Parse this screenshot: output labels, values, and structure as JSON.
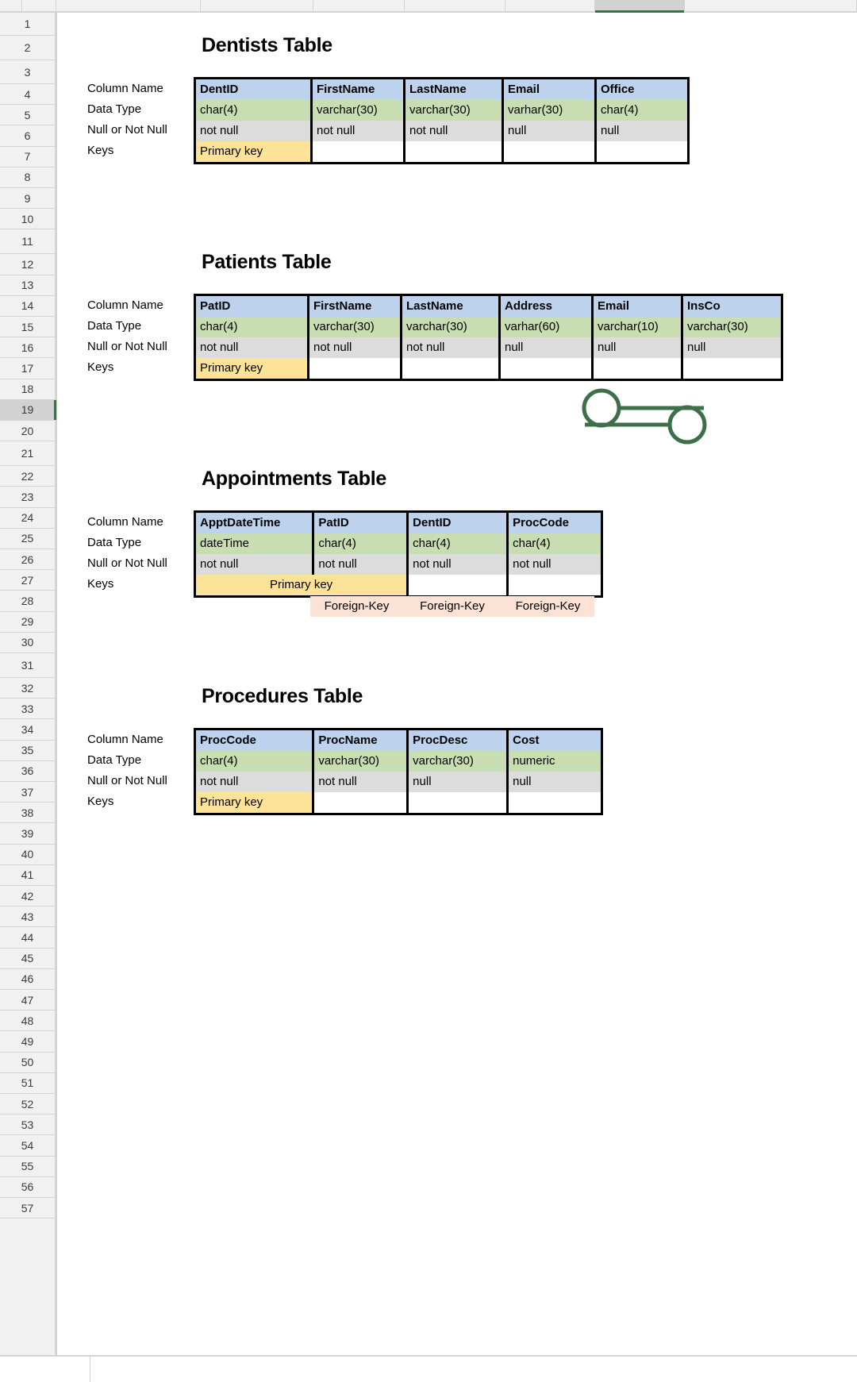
{
  "app": {
    "type": "spreadsheet",
    "selected_row": "19"
  },
  "row_headers": [
    "1",
    "2",
    "3",
    "4",
    "5",
    "6",
    "7",
    "8",
    "9",
    "10",
    "11",
    "12",
    "13",
    "14",
    "15",
    "16",
    "17",
    "18",
    "19",
    "20",
    "21",
    "22",
    "23",
    "24",
    "25",
    "26",
    "27",
    "28",
    "29",
    "30",
    "31",
    "32",
    "33",
    "34",
    "35",
    "36",
    "37",
    "38",
    "39",
    "40",
    "41",
    "42",
    "43",
    "44",
    "45",
    "46",
    "47",
    "48",
    "49",
    "50",
    "51",
    "52",
    "53",
    "54",
    "55",
    "56",
    "57"
  ],
  "row_labels": {
    "column_name": "Column Name",
    "data_type": "Data Type",
    "null_or_not_null": "Null or Not Null",
    "keys": "Keys"
  },
  "colors": {
    "header_blue": "#bdd2ec",
    "type_green": "#c9ddb2",
    "null_gray": "#dcdcdc",
    "primary_key_yellow": "#fce398",
    "foreign_key_peach": "#fbe2d5",
    "link_green": "#3d7049",
    "selection_green": "#3d7049"
  },
  "tables": [
    {
      "title": "Dentists Table",
      "columns": [
        {
          "name": "DentID",
          "type": "char(4)",
          "null": "not null",
          "key": "Primary key"
        },
        {
          "name": "FirstName",
          "type": "varchar(30)",
          "null": "not null",
          "key": ""
        },
        {
          "name": "LastName",
          "type": "varchar(30)",
          "null": "not null",
          "key": ""
        },
        {
          "name": "Email",
          "type": "varhar(30)",
          "null": "null",
          "key": ""
        },
        {
          "name": "Office",
          "type": "char(4)",
          "null": "null",
          "key": ""
        }
      ]
    },
    {
      "title": "Patients Table",
      "columns": [
        {
          "name": "PatID",
          "type": "char(4)",
          "null": "not null",
          "key": "Primary key"
        },
        {
          "name": "FirstName",
          "type": "varchar(30)",
          "null": "not null",
          "key": ""
        },
        {
          "name": "LastName",
          "type": "varchar(30)",
          "null": "not null",
          "key": ""
        },
        {
          "name": "Address",
          "type": "varhar(60)",
          "null": "null",
          "key": ""
        },
        {
          "name": "Email",
          "type": "varchar(10)",
          "null": "null",
          "key": ""
        },
        {
          "name": "InsCo",
          "type": "varchar(30)",
          "null": "null",
          "key": ""
        }
      ]
    },
    {
      "title": "Appointments Table",
      "columns": [
        {
          "name": "ApptDateTime",
          "type": "dateTime",
          "null": "not null",
          "key": "Primary key"
        },
        {
          "name": "PatID",
          "type": "char(4)",
          "null": "not null",
          "key": ""
        },
        {
          "name": "DentID",
          "type": "char(4)",
          "null": "not null",
          "key": ""
        },
        {
          "name": "ProcCode",
          "type": "char(4)",
          "null": "not null",
          "key": ""
        }
      ],
      "primary_key_span": 2,
      "foreign_keys": [
        "",
        "Foreign-Key",
        "Foreign-Key",
        "Foreign-Key"
      ]
    },
    {
      "title": "Procedures Table",
      "columns": [
        {
          "name": "ProcCode",
          "type": "char(4)",
          "null": "not null",
          "key": "Primary key"
        },
        {
          "name": "ProcName",
          "type": "varchar(30)",
          "null": "not null",
          "key": ""
        },
        {
          "name": "ProcDesc",
          "type": "varchar(30)",
          "null": "null",
          "key": ""
        },
        {
          "name": "Cost",
          "type": "numeric",
          "null": "null",
          "key": ""
        }
      ]
    }
  ],
  "decorations": [
    {
      "name": "link-chain-icon",
      "shape": "two-linked-rings"
    }
  ]
}
